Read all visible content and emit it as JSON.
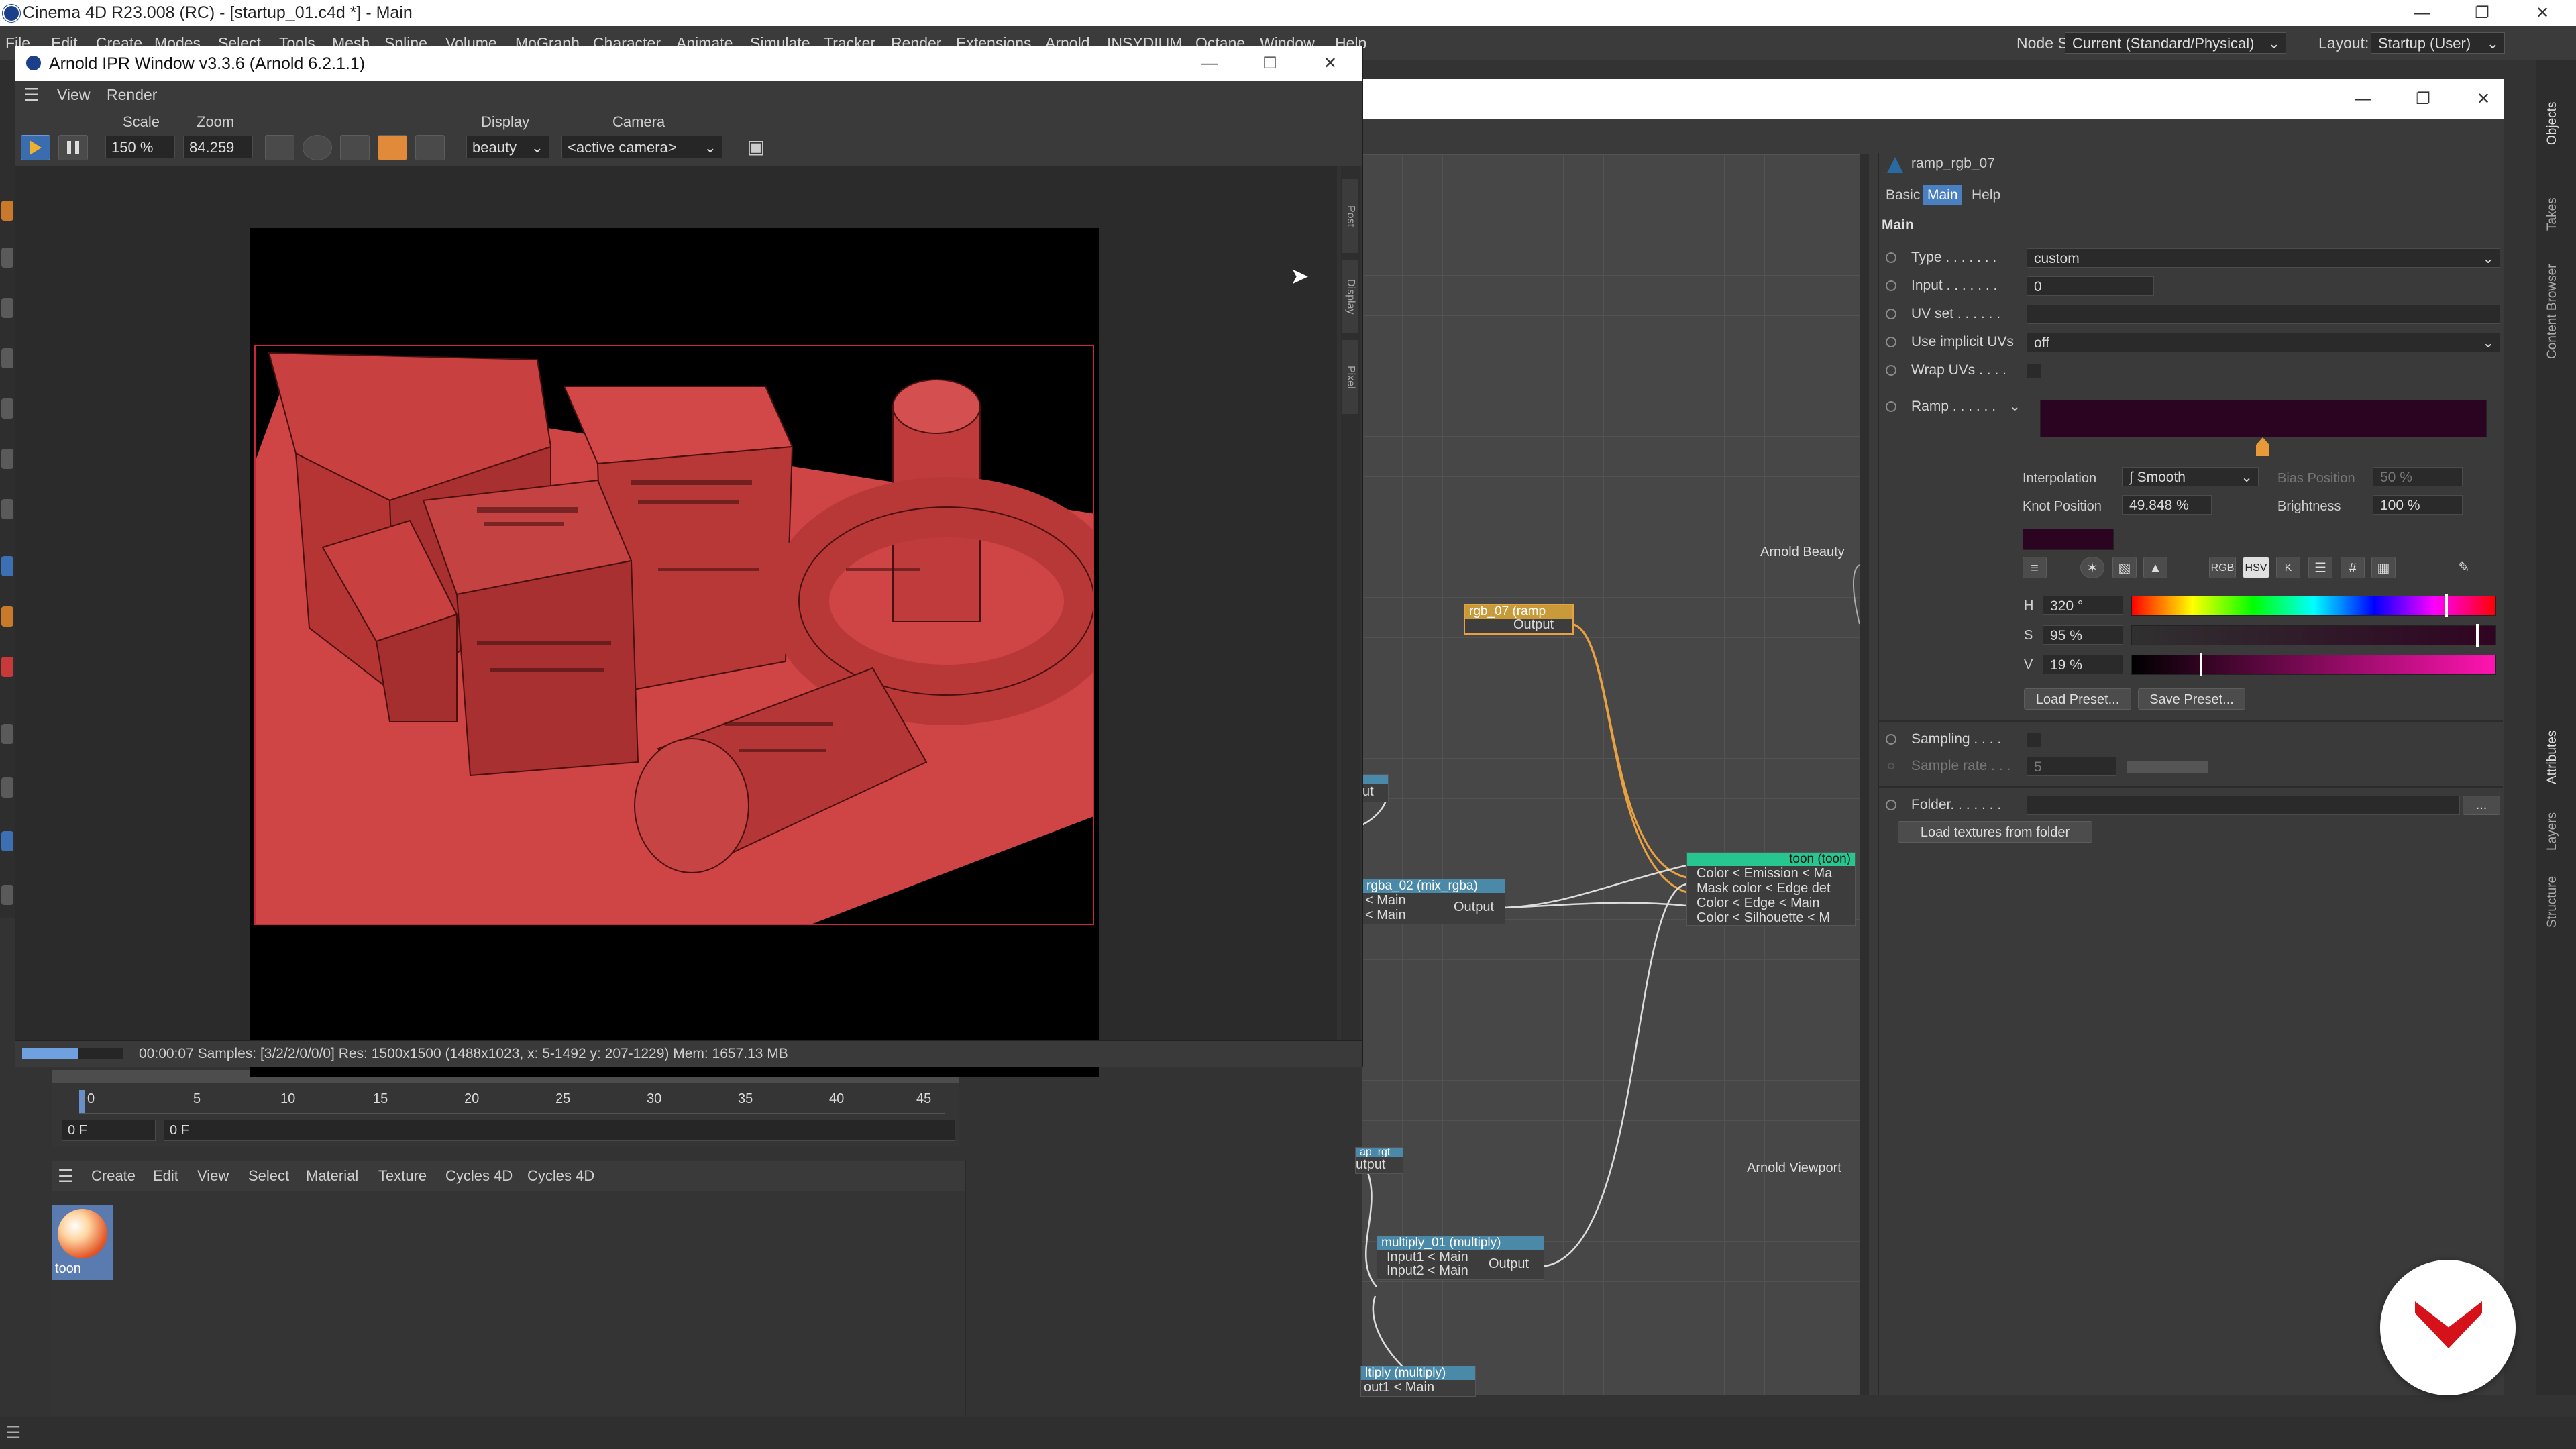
{
  "app": {
    "window_title": "Cinema 4D R23.008 (RC) - [startup_01.c4d *] - Main",
    "node_space_label": "Node Space:",
    "node_space_value": "Current (Standard/Physical)",
    "layout_label": "Layout:",
    "layout_value": "Startup (User)",
    "menus": [
      "File",
      "Edit",
      "Create",
      "Modes",
      "Select",
      "Tools",
      "Mesh",
      "Spline",
      "Volume",
      "MoGraph",
      "Character",
      "Animate",
      "Simulate",
      "Tracker",
      "Render",
      "Extensions",
      "Arnold",
      "INSYDIUM",
      "Octane",
      "Window",
      "Help"
    ]
  },
  "ipr": {
    "title": "Arnold IPR Window v3.3.6 (Arnold 6.2.1.1)",
    "menus": [
      "View",
      "Render"
    ],
    "scale_label": "Scale",
    "scale_value": "150 %",
    "zoom_label": "Zoom",
    "zoom_value": "84.259",
    "display_label": "Display",
    "display_value": "beauty",
    "camera_label": "Camera",
    "camera_value": "<active camera>",
    "side_tabs": [
      "Post",
      "Display",
      "Pixel"
    ],
    "status": "00:00:07  Samples: [3/2/2/0/0/0]  Res: 1500x1500 (1488x1023, x: 5-1492 y: 207-1229)  Mem: 1657.13 MB",
    "progress": 0.55
  },
  "node_editor": {
    "canvas_title": "toon",
    "labels": {
      "arnold_beauty": "Arnold Beauty",
      "arnold_viewport": "Arnold Viewport"
    },
    "nodes": {
      "ramp": {
        "title": "rgb_07 (ramp",
        "out": "Output"
      },
      "mix": {
        "title": "rgba_02 (mix_rgba)",
        "in1": "< Main",
        "in2": "< Main",
        "out": "Output"
      },
      "toon": {
        "title": "toon (toon)",
        "ports": [
          "Color < Emission < Ma",
          "Mask color < Edge det",
          "Color < Edge < Main",
          "Color < Silhouette < M"
        ]
      },
      "multiply1": {
        "title": "multiply_01 (multiply)",
        "in1": "Input1 < Main",
        "in2": "Input2 < Main",
        "out": "Output"
      },
      "multiply2": {
        "title": "ltiply (multiply)",
        "in1": "out1 < Main"
      },
      "stub1": {
        "title": "ut"
      },
      "stub2": {
        "title": "ap_rgt",
        "out": "utput"
      }
    }
  },
  "attributes": {
    "node_name": "ramp_rgb_07",
    "tabs": [
      "Basic",
      "Main",
      "Help"
    ],
    "active_tab": "Main",
    "section": "Main",
    "type_label": "Type . . . . . . .",
    "type_value": "custom",
    "input_label": "Input . . . . . . .",
    "input_value": "0",
    "uvset_label": "UV set . . . . . .",
    "implicit_label": "Use implicit UVs",
    "implicit_value": "off",
    "wrap_label": "Wrap UVs . . . .",
    "ramp_label": "Ramp . . . . . .",
    "interpolation_label": "Interpolation",
    "interpolation_value": "Smooth",
    "knot_label": "Knot Position",
    "knot_value": "49.848 %",
    "bias_label": "Bias Position",
    "bias_value": "50 %",
    "brightness_label": "Brightness",
    "brightness_value": "100 %",
    "color_modes": [
      "RGB",
      "HSV",
      "K"
    ],
    "h_label": "H",
    "h_value": "320 °",
    "s_label": "S",
    "s_value": "95 %",
    "v_label": "V",
    "v_value": "19 %",
    "load_preset": "Load Preset...",
    "save_preset": "Save Preset...",
    "sampling_label": "Sampling . . . .",
    "sample_rate_label": "Sample rate . . .",
    "sample_rate_value": "5",
    "folder_label": "Folder. . . . . . .",
    "folder_btn": "...",
    "load_textures": "Load textures from folder",
    "ramp_color": "#2a0420"
  },
  "timeline": {
    "ticks": [
      "0",
      "5",
      "10",
      "15",
      "20",
      "25",
      "30",
      "35",
      "40",
      "45"
    ],
    "frame_start": "0 F",
    "frame_current": "0 F"
  },
  "material_manager": {
    "menus": [
      "Create",
      "Edit",
      "View",
      "Select",
      "Material",
      "Texture",
      "Cycles 4D",
      "Cycles 4D"
    ],
    "material_name": "toon"
  },
  "right_dock_tabs": [
    "Objects",
    "Takes",
    "Content Browser",
    "Attributes",
    "Layers",
    "Structure"
  ],
  "colors": {
    "render_red": "#d64a4a",
    "accent_blue": "#4a7fc1",
    "toon_header": "#27c58f",
    "wire_orange": "#e8a040"
  }
}
